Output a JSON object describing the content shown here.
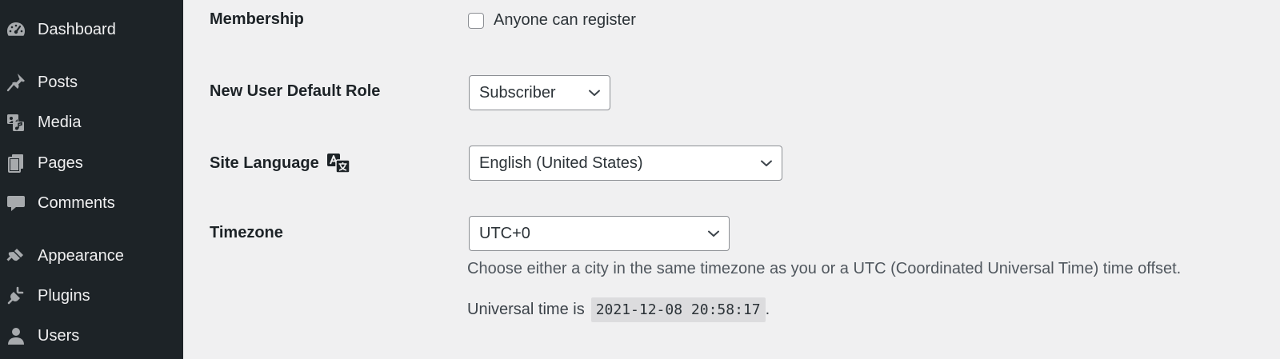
{
  "sidebar": {
    "items": [
      {
        "label": "Dashboard",
        "icon": "dashboard-icon"
      },
      {
        "label": "Posts",
        "icon": "pin-icon"
      },
      {
        "label": "Media",
        "icon": "media-icon"
      },
      {
        "label": "Pages",
        "icon": "pages-icon"
      },
      {
        "label": "Comments",
        "icon": "comment-icon"
      },
      {
        "label": "Appearance",
        "icon": "brush-icon"
      },
      {
        "label": "Plugins",
        "icon": "plug-icon"
      },
      {
        "label": "Users",
        "icon": "user-icon"
      }
    ]
  },
  "settings": {
    "membership": {
      "label": "Membership",
      "checkbox_label": "Anyone can register",
      "checked": false
    },
    "default_role": {
      "label": "New User Default Role",
      "value": "Subscriber"
    },
    "site_language": {
      "label": "Site Language",
      "icon": "translation-icon",
      "value": "English (United States)"
    },
    "timezone": {
      "label": "Timezone",
      "value": "UTC+0",
      "description": "Choose either a city in the same timezone as you or a UTC (Coordinated Universal Time) time offset.",
      "universal_prefix": "Universal time is",
      "universal_time": "2021-12-08 20:58:17",
      "universal_suffix": "."
    }
  },
  "colors": {
    "sidebar_bg": "#1d2327",
    "sidebar_text": "#f0f0f1",
    "sidebar_icon": "#a7aaad",
    "page_bg": "#f0f0f1",
    "code_bg": "#dcdcde"
  }
}
